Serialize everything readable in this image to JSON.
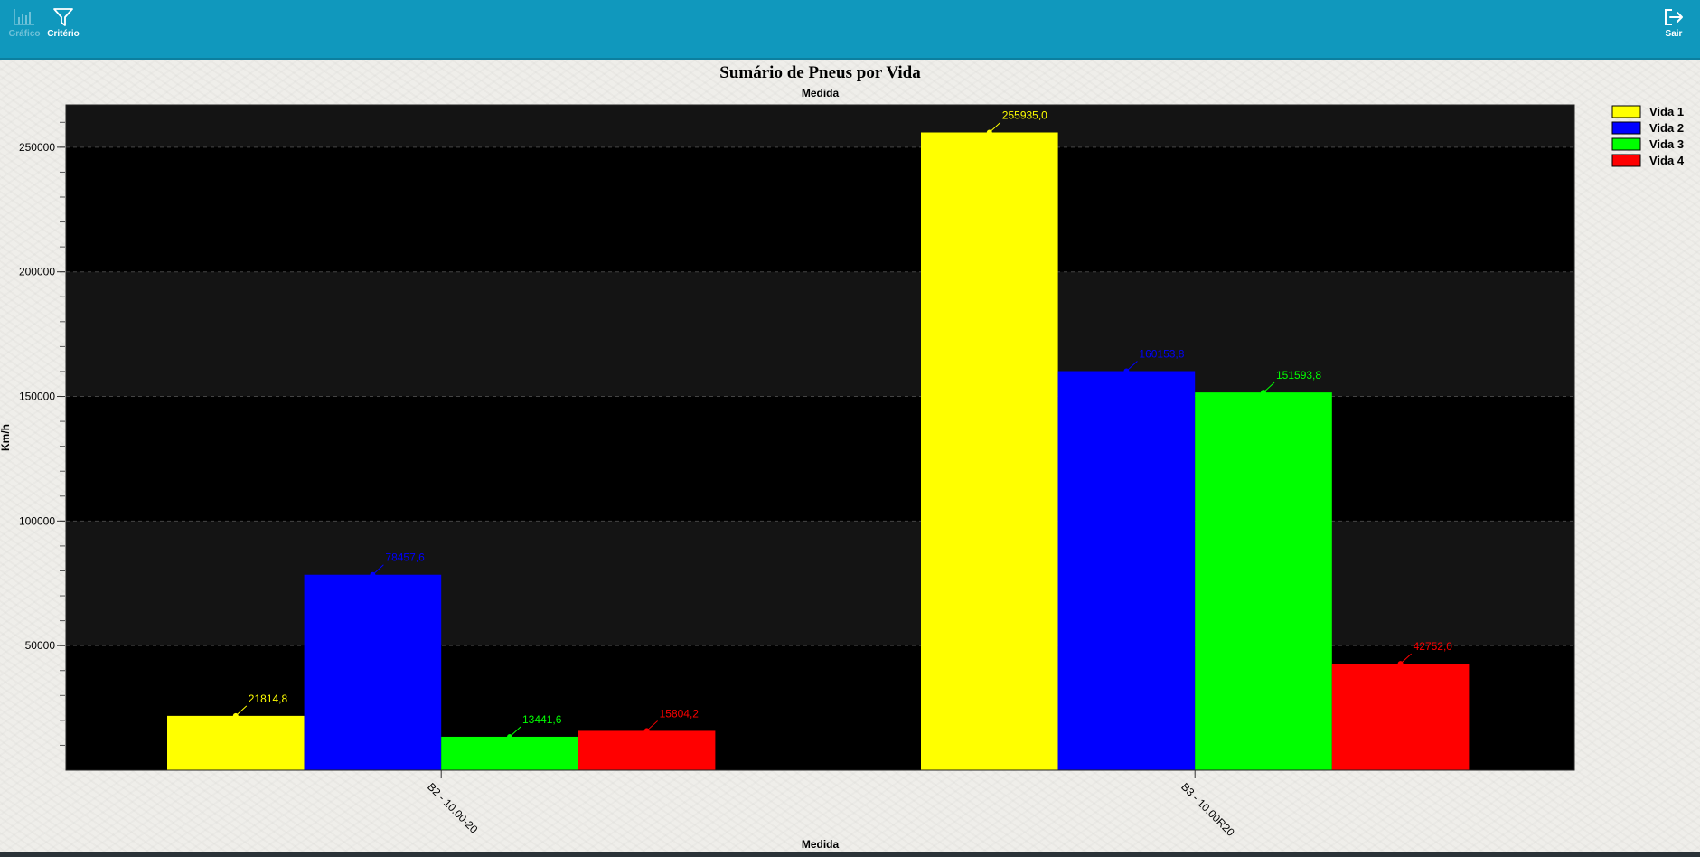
{
  "toolbar": {
    "grafico": {
      "label": "Gráfico",
      "icon": "bar-chart-icon"
    },
    "criterio": {
      "label": "Critério",
      "icon": "filter-icon"
    },
    "sair": {
      "label": "Sair",
      "icon": "logout-icon"
    }
  },
  "chart_data": {
    "type": "bar",
    "title": "Sumário de Pneus por Vida",
    "subtitle": "Medida",
    "xlabel": "Medida",
    "ylabel": "Km/h",
    "categories": [
      "B2 - 10.00-20",
      "B3 - 10.00R20"
    ],
    "series": [
      {
        "name": "Vida 1",
        "color": "#ffff00",
        "values": [
          21814.8,
          255935.0
        ],
        "labels": [
          "21814,8",
          "255935,0"
        ]
      },
      {
        "name": "Vida 2",
        "color": "#0000ff",
        "values": [
          78457.6,
          160153.8
        ],
        "labels": [
          "78457,6",
          "160153,8"
        ]
      },
      {
        "name": "Vida 3",
        "color": "#00ff00",
        "values": [
          13441.6,
          151593.8
        ],
        "labels": [
          "13441,6",
          "151593,8"
        ]
      },
      {
        "name": "Vida 4",
        "color": "#ff0000",
        "values": [
          15804.2,
          42752.0
        ],
        "labels": [
          "15804,2",
          "42752,0"
        ]
      }
    ],
    "yticks": [
      50000,
      100000,
      150000,
      200000,
      250000
    ],
    "ylim": [
      0,
      267000
    ],
    "grid": true,
    "legend": "top-right",
    "plot_background": "#000000"
  }
}
